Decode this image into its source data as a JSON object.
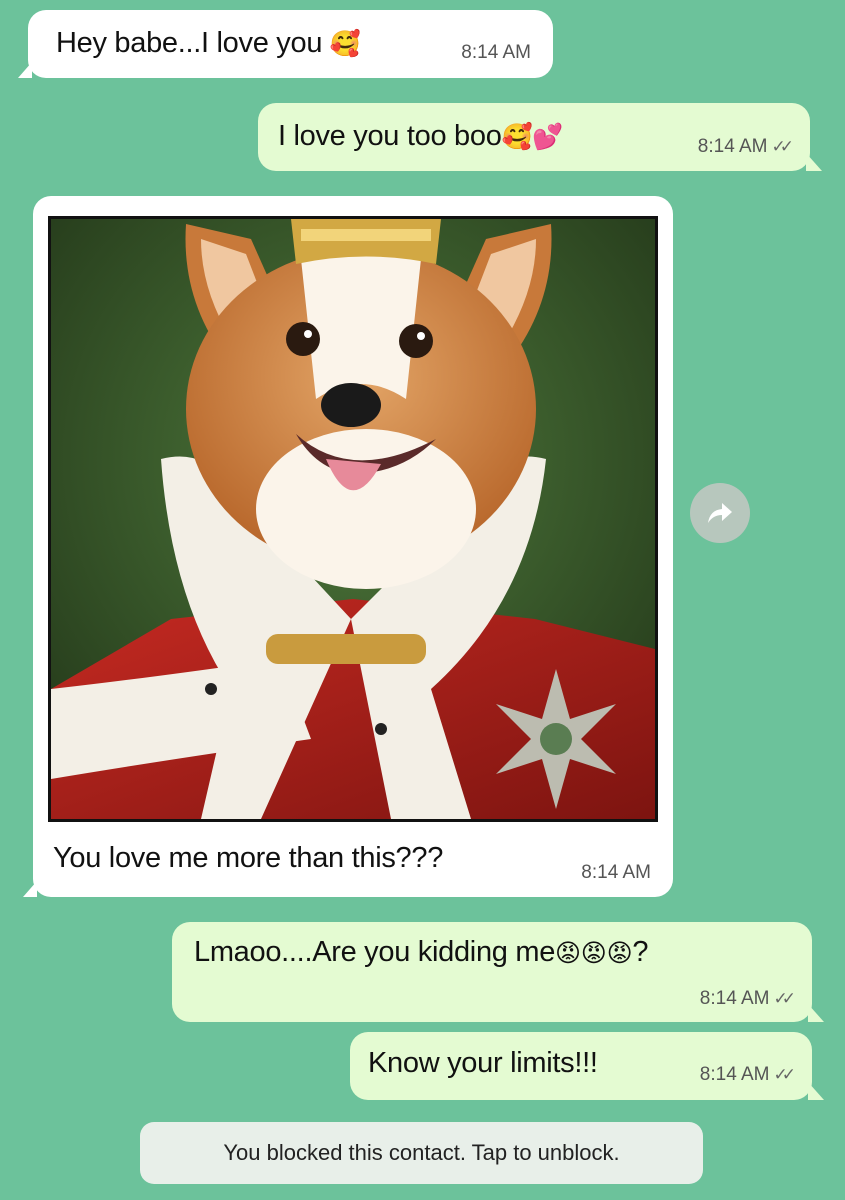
{
  "messages": [
    {
      "direction": "incoming",
      "text": "Hey babe...I love you",
      "emoji": "🥰",
      "time": "8:14 AM"
    },
    {
      "direction": "outgoing",
      "text": "I love you too boo",
      "emoji": "🥰💕",
      "time": "8:14 AM",
      "ticks": "✓✓"
    },
    {
      "direction": "incoming",
      "image_icon": "corgi-king-portrait",
      "caption": "You love me more than this???",
      "time": "8:14 AM"
    },
    {
      "direction": "outgoing",
      "text": "Lmaoo....Are you kidding me",
      "emoji": "😡😡😡",
      "suffix": "?",
      "time": "8:14 AM",
      "ticks": "✓✓"
    },
    {
      "direction": "outgoing",
      "text": "Know your limits!!!",
      "time": "8:14 AM",
      "ticks": "✓✓"
    }
  ],
  "system_notice": "You blocked this contact. Tap to unblock.",
  "forward_icon": "forward-arrow-icon",
  "colors": {
    "chat_background": "#6cc29b",
    "incoming_bubble": "#ffffff",
    "outgoing_bubble": "#e4fbd2",
    "system_notice_bg": "#e8efe9"
  }
}
